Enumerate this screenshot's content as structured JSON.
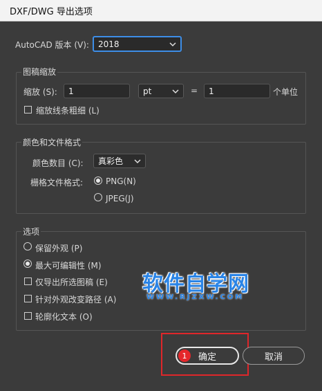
{
  "window": {
    "title": "DXF/DWG 导出选项"
  },
  "autocad": {
    "label": "AutoCAD 版本 (V):",
    "value": "2018"
  },
  "scaling": {
    "legend": "图稿缩放",
    "scale_label": "缩放 (S):",
    "scale_value": "1",
    "unit_value": "pt",
    "equals": "=",
    "unit_value_right": "1",
    "unit_suffix": "个单位",
    "scale_lineweights_label": "缩放线条粗细 (L)"
  },
  "color_format": {
    "legend": "颜色和文件格式",
    "color_count_label": "颜色数目 (C):",
    "color_count_value": "真彩色",
    "raster_label": "栅格文件格式:",
    "png_label": "PNG(N)",
    "jpeg_label": "JPEG(J)"
  },
  "options": {
    "legend": "选项",
    "preserve_appearance": "保留外观 (P)",
    "max_editability": "最大可编辑性 (M)",
    "export_selected": "仅导出所选图稿 (E)",
    "alter_paths": "针对外观改变路径 (A)",
    "outline_text": "轮廓化文本 (O)"
  },
  "buttons": {
    "ok": "确定",
    "cancel": "取消",
    "badge": "1"
  },
  "watermark": {
    "text": "软件自学网",
    "sub": "WWW.RJZXW.COM"
  },
  "colors": {
    "accent": "#3d8ee8",
    "highlight": "#e0262a",
    "badge": "#e5272b",
    "bg": "#3b3b3b"
  }
}
